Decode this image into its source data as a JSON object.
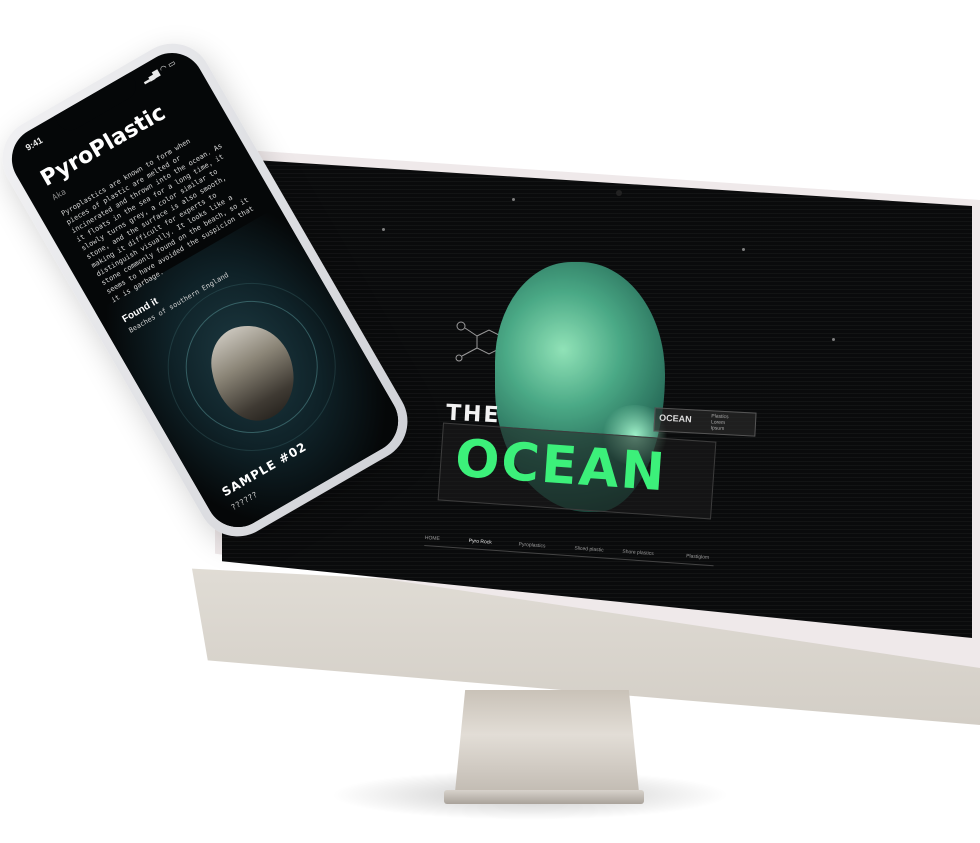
{
  "phone": {
    "time": "9:41",
    "title": "PyroPlastic",
    "subtitle": "Aka",
    "body": "Pyroplastics are known to form when pieces of plastic are melted or incinerated and thrown into the ocean. As it floats in the sea for a long time, it slowly turns grey, a color similar to stone, and the surface is also smooth, making it difficult for experts to distinguish visually. It looks like a stone commonly found on the beach, so it seems to have avoided the suspicion that it is garbage.",
    "found_label": "Found it",
    "found_value": "Beaches of southern England",
    "sample_label": "SAMPLE #02",
    "sample_value": "??????"
  },
  "desktop": {
    "the_label": "THE",
    "ocean_label": "OCEAN",
    "mini_title": "OCEAN",
    "mini_info": [
      "Plastics",
      "Lorem",
      "Ipsum"
    ],
    "nav": [
      "HOME",
      "Pyro Rock",
      "Pyroplastics",
      "Sliced plastic",
      "Shore plastics",
      "Plastiglom"
    ],
    "active_nav": "Pyro Rock"
  },
  "colors": {
    "accent": "#3cf07a",
    "screen_bg": "#0a0b0c",
    "frame": "#efe9ea",
    "chin": "#d6d1c9"
  }
}
